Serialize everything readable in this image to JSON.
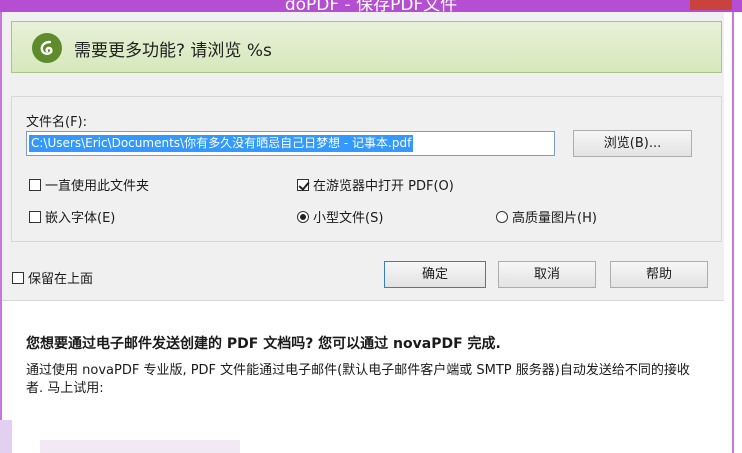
{
  "window": {
    "title": "doPDF - 保存PDF文件"
  },
  "banner": {
    "text": "需要更多功能? 请浏览 %s",
    "icon": "nova-logo-icon"
  },
  "form": {
    "file_label": "文件名(F):",
    "file_value": "C:\\Users\\Eric\\Documents\\你有多久没有晒忌自己日梦想 - 记事本.pdf",
    "browse_label": "浏览(B)...",
    "options": {
      "always_use_folder": {
        "label": "一直使用此文件夹",
        "checked": false
      },
      "open_in_browser": {
        "label": "在游览器中打开 PDF(O)",
        "checked": true
      },
      "embed_fonts": {
        "label": "嵌入字体(E)",
        "checked": false
      },
      "small_file": {
        "label": "小型文件(S)",
        "checked": true
      },
      "high_quality": {
        "label": "高质量图片(H)",
        "checked": false
      }
    }
  },
  "footer": {
    "keep_on_top": {
      "label": "保留在上面",
      "checked": false
    },
    "ok_label": "确定",
    "cancel_label": "取消",
    "help_label": "帮助"
  },
  "promo": {
    "title": "您想要通过电子邮件发送创建的 PDF 文档吗? 您可以通过 novaPDF 完成.",
    "body": "通过使用 novaPDF 专业版, PDF 文件能通过电子邮件(默认电子邮件客户端或 SMTP 服务器)自动发送给不同的接收者. 马上试用:"
  },
  "colors": {
    "title_bar": "#b64ed3",
    "banner_bg": "#dcebc6",
    "selection": "#3399ff"
  }
}
